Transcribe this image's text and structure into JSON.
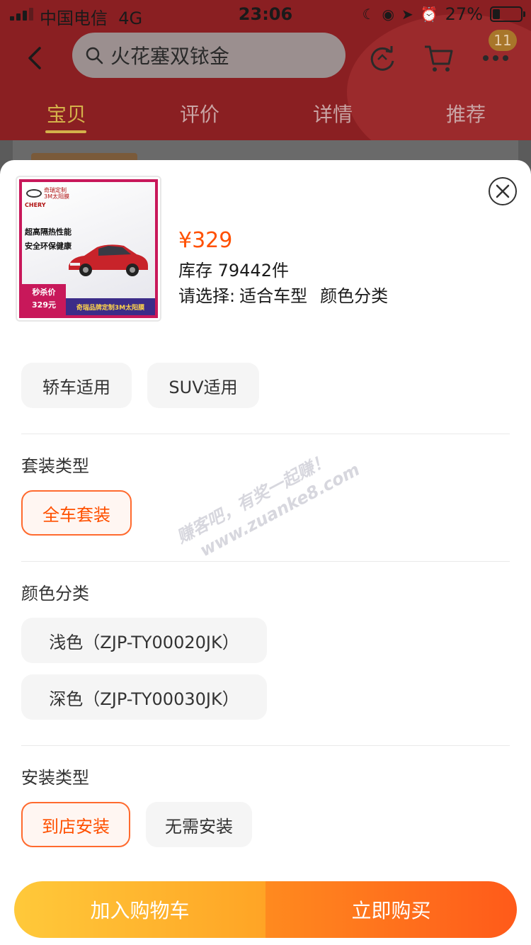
{
  "status_bar": {
    "carrier": "中国电信",
    "network": "4G",
    "time": "23:06",
    "battery_percent": "27%",
    "battery_level": 0.27
  },
  "nav": {
    "search_text": "火花塞双铱金",
    "cart_badge": "11"
  },
  "tabs": [
    {
      "label": "宝贝",
      "active": true
    },
    {
      "label": "评价",
      "active": false
    },
    {
      "label": "详情",
      "active": false
    },
    {
      "label": "推荐",
      "active": false
    }
  ],
  "product": {
    "image_text": {
      "brand_line1": "奇瑞定制",
      "brand_line2": "3M太阳膜",
      "brand_en": "CHERY",
      "slogan1": "超高隔热性能",
      "slogan2": "安全环保健康",
      "promo1": "秒杀价",
      "promo2": "329元",
      "banner": "奇瑞品牌定制3M太阳膜"
    },
    "price": "¥329",
    "stock": "库存 79442件",
    "select_prefix": "请选择:",
    "select_options": [
      "适合车型",
      "颜色分类"
    ]
  },
  "sections": {
    "car_type": {
      "options": [
        {
          "label": "轿车适用",
          "selected": false
        },
        {
          "label": "SUV适用",
          "selected": false
        }
      ]
    },
    "package_type": {
      "title": "套装类型",
      "options": [
        {
          "label": "全车套装",
          "selected": true
        }
      ]
    },
    "color": {
      "title": "颜色分类",
      "options": [
        {
          "label": "浅色（ZJP-TY00020JK）",
          "selected": false
        },
        {
          "label": "深色（ZJP-TY00030JK）",
          "selected": false
        }
      ]
    },
    "install": {
      "title": "安装类型",
      "options": [
        {
          "label": "到店安装",
          "selected": true
        },
        {
          "label": "无需安装",
          "selected": false
        }
      ]
    }
  },
  "watermark": {
    "line1": "赚客吧，有奖一起赚！",
    "line2": "www.zuanke8.com"
  },
  "buttons": {
    "add_to_cart": "加入购物车",
    "buy_now": "立即购买"
  },
  "colors": {
    "accent": "#ff5000",
    "header_dim": "#8a1f22"
  }
}
